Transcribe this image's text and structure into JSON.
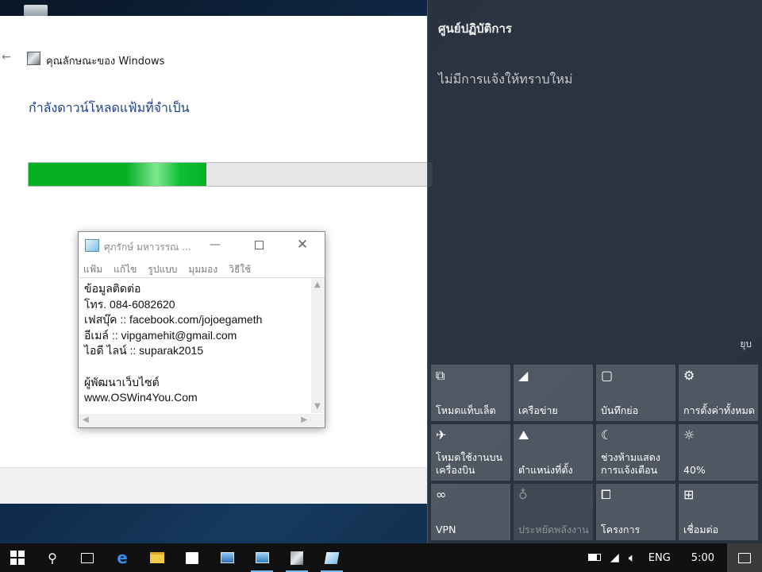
{
  "features_window": {
    "title": "คุณลักษณะของ Windows",
    "heading": "กำลังดาวน์โหลดแฟ้มที่จำเป็น",
    "progress_fraction": 0.44
  },
  "notepad": {
    "title": "ศุภรักษ์ มหาวรรณ ...",
    "menu": [
      "แฟ้ม",
      "แก้ไข",
      "รูปแบบ",
      "มุมมอง",
      "วิธีใช้"
    ],
    "lines": [
      "ข้อมูลติดต่อ",
      "โทร. 084-6082620",
      "เฟสบุ๊ค :: facebook.com/jojoegameth",
      "อีเมล์ :: vipgamehit@gmail.com",
      "ไอดี ไลน์ :: suparak2015",
      "",
      "ผู้พัฒนาเว็บไซต์",
      "www.OSWin4You.Com"
    ]
  },
  "action_center": {
    "title": "ศูนย์ปฏิบัติการ",
    "empty_message": "ไม่มีการแจ้งให้ทราบใหม่",
    "collapse_label": "ยุบ",
    "tiles": [
      {
        "label": "โหมดแท็บเล็ต",
        "icon": "tablet-mode-icon",
        "glyph": "⧉",
        "state": "normal"
      },
      {
        "label": "เครือข่าย",
        "icon": "network-icon",
        "glyph": "◢",
        "state": "normal"
      },
      {
        "label": "บันทึกย่อ",
        "icon": "note-icon",
        "glyph": "▢",
        "state": "normal"
      },
      {
        "label": "การตั้งค่าทั้งหมด",
        "icon": "settings-gear-icon",
        "glyph": "⚙",
        "state": "normal"
      },
      {
        "label": "โหมดใช้งานบนเครื่องบิน",
        "icon": "airplane-icon",
        "glyph": "✈",
        "state": "normal"
      },
      {
        "label": "ตำแหน่งที่ตั้ง",
        "icon": "location-icon",
        "glyph": "⛰",
        "state": "normal"
      },
      {
        "label": "ช่วงห้ามแสดงการแจ้งเตือน",
        "icon": "moon-icon",
        "glyph": "☾",
        "state": "normal"
      },
      {
        "label": "40%",
        "icon": "brightness-sun-icon",
        "glyph": "☼",
        "state": "normal"
      },
      {
        "label": "VPN",
        "icon": "vpn-icon",
        "glyph": "∞",
        "state": "normal"
      },
      {
        "label": "ประหยัดพลังงาน",
        "icon": "battery-saver-icon",
        "glyph": "♁",
        "state": "disabled"
      },
      {
        "label": "โครงการ",
        "icon": "project-icon",
        "glyph": "⧠",
        "state": "normal"
      },
      {
        "label": "เชื่อมต่อ",
        "icon": "connect-icon",
        "glyph": "⊞",
        "state": "normal"
      }
    ]
  },
  "taskbar": {
    "language": "ENG",
    "time": "5:00"
  },
  "colors": {
    "progress_green": "#06b025",
    "heading_blue": "#1e3f8a",
    "taskbar": "#101010",
    "action_center_bg": "#2c343e"
  }
}
